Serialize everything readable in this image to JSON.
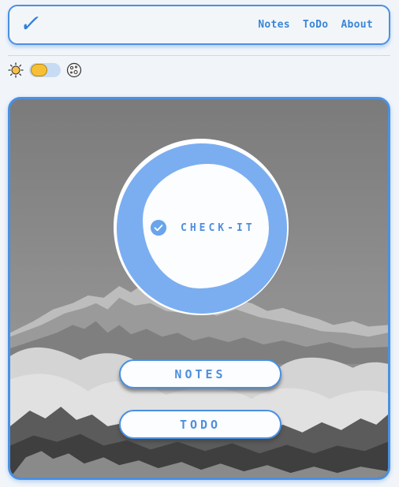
{
  "navbar": {
    "logo_glyph": "✓",
    "links": [
      {
        "label": "Notes"
      },
      {
        "label": "ToDo"
      },
      {
        "label": "About"
      }
    ]
  },
  "theme": {
    "light_icon": "sun-icon",
    "dark_icon": "moon-icon",
    "mode": "light",
    "toggle_color": "#f6bf36"
  },
  "hero": {
    "badge_text": "CHECK-IT",
    "badge_icon": "check-circle-icon",
    "buttons": [
      {
        "label": "NOTES"
      },
      {
        "label": "TODO"
      }
    ]
  },
  "colors": {
    "accent": "#4a90e2",
    "ring": "#7baef0",
    "background": "#f1f5f9"
  }
}
